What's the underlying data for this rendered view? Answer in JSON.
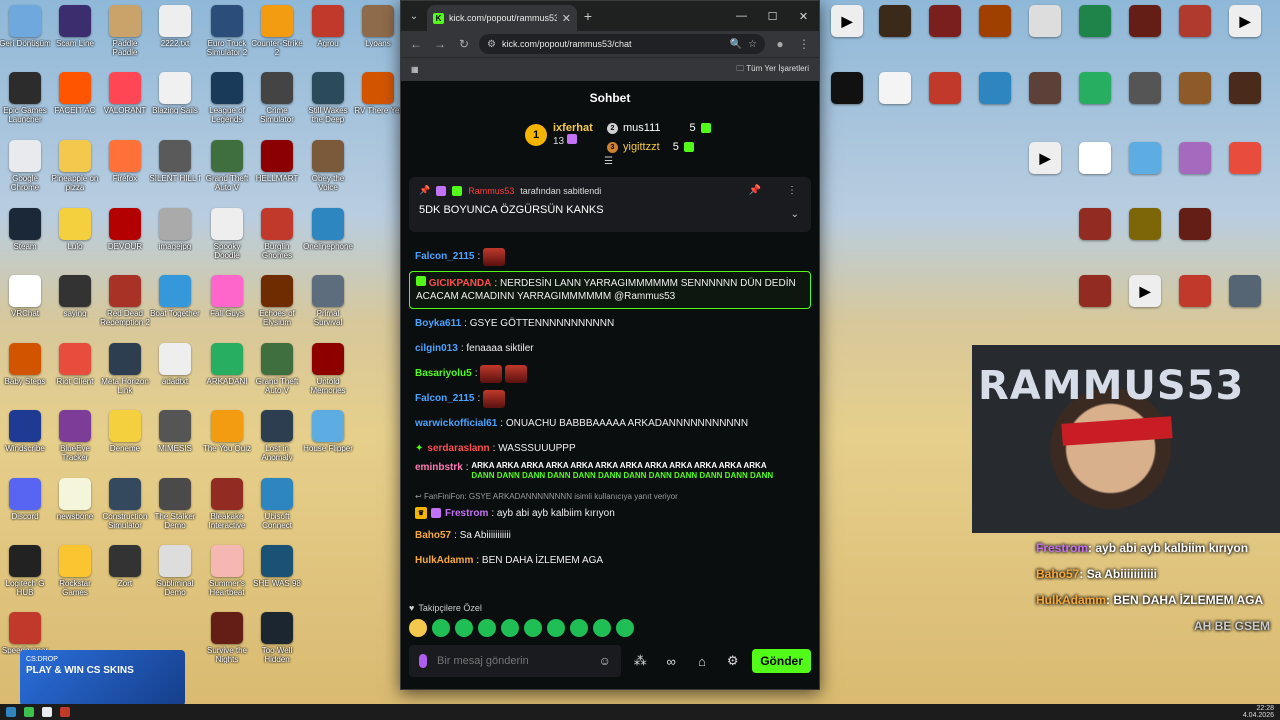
{
  "browser": {
    "tab_title": "kick.com/popout/rammus53/ch",
    "url": "kick.com/popout/rammus53/chat",
    "bookmarks_label": "Tüm Yer İşaretleri"
  },
  "chat": {
    "title": "Sohbet",
    "leaders": [
      {
        "rank": "1",
        "name": "ixferhat",
        "count": "13"
      },
      {
        "rank": "2",
        "name": "mus111",
        "count": "5"
      },
      {
        "rank": "3",
        "name": "yigittzzt",
        "count": "5"
      }
    ],
    "pinned": {
      "user": "Rammus53",
      "suffix": "tarafından sabitlendi",
      "message": "5DK BOYUNCA ÖZGÜRSÜN KANKS"
    },
    "messages": [
      {
        "user": "Falcon_2115",
        "color": "#4aa3ff",
        "text": ""
      },
      {
        "user": "GICIKPANDA",
        "color": "#ff4d4d",
        "text": "NERDESİN LANN YARRAGIMMMMMM SENNNNNN DÜN DEDİN ACACAM ACMADINN YARRAGIMMMMMM @Rammus53"
      },
      {
        "user": "Boyka611",
        "color": "#4aa3ff",
        "text": "GSYE GÖTTENNNNNNNNNNN"
      },
      {
        "user": "cilgin013",
        "color": "#4aa3ff",
        "text": "fenaaaa siktiler"
      },
      {
        "user": "Basariyolu5",
        "color": "#53fc18",
        "text": ""
      },
      {
        "user": "Falcon_2115",
        "color": "#4aa3ff",
        "text": ""
      },
      {
        "user": "warwickofficial61",
        "color": "#4aa3ff",
        "text": "ONUACHU BABBBAAAAA ARKADANNNNNNNNNNN"
      },
      {
        "user": "serdaraslann",
        "color": "#ff4d4d",
        "text": "WASSSUUUPPP"
      },
      {
        "user": "eminbstrk",
        "color": "#ff7ab6",
        "text1": "ARKA ARKA ARKA ARKA ARKA ARKA ARKA ARKA ARKA ARKA ARKA ARKA",
        "text2": "DANN DANN DANN DANN DANN DANN DANN DANN DANN DANN DANN DANN"
      },
      {
        "reply": "FanFiniFon: GSYE ARKADANNNNNNNN isimli kullanıcıya yanıt veriyor",
        "user": "Frestrom",
        "color": "#c472f5",
        "text": "ayb abi ayb kalbiim kırıyon"
      },
      {
        "user": "Baho57",
        "color": "#f7a93b",
        "text": "Sa Abiiiiiiiiiii"
      },
      {
        "user": "HulkAdamm",
        "color": "#f7a93b",
        "text": "BEN DAHA İZLEMEM AGA"
      }
    ],
    "follow_only": "Takipçilere Özel",
    "input_placeholder": "Bir mesaj gönderin",
    "send_label": "Gönder"
  },
  "overlay": {
    "brand": "RAMMUS53",
    "lines": [
      {
        "user": "Frestrom",
        "text": "ayb abi ayb kalbiim kırıyon",
        "color": "#c472f5"
      },
      {
        "user": "Baho57",
        "text": "Sa Abiiiiiiiiiii",
        "color": "#f7a93b"
      },
      {
        "user": "HulkAdamm",
        "text": "BEN DAHA İZLEMEM AGA",
        "color": "#f7a93b"
      },
      {
        "user": "",
        "text": "AH BE GSEM",
        "color": "#cccccc"
      }
    ]
  },
  "promo": {
    "tag": "CS:DROP",
    "headline": "PLAY & WIN CS SKINS"
  },
  "taskbar": {
    "time": "22:28",
    "date": "4.04.2026"
  },
  "desktop_left": [
    [
      "Geri Dönüşüm",
      "#6fa8dc"
    ],
    [
      "Scam Line",
      "#3b2d6e"
    ],
    [
      "Paddle Paddle",
      "#caa36a"
    ],
    [
      "2222.txt",
      "#eeeeee"
    ],
    [
      "Euro Truck Simulator 2",
      "#2b4d7a"
    ],
    [
      "Counter-Strike 2",
      "#f39c12"
    ],
    [
      "Agrou",
      "#c0392b"
    ],
    [
      "Lyoans",
      "#8e6b4a"
    ],
    [
      "Epic Games Launcher",
      "#2c2c2c"
    ],
    [
      "FACEIT AC",
      "#ff5500"
    ],
    [
      "VALORANT",
      "#ff4655"
    ],
    [
      "Blazing Sails",
      "#f0f0f0"
    ],
    [
      "League of Legends",
      "#1a3a5a"
    ],
    [
      "Crime Simulator",
      "#444444"
    ],
    [
      "Still Wakes the Deep",
      "#2b4a5a"
    ],
    [
      "RV There Yet",
      "#d35400"
    ],
    [
      "Google Chrome",
      "#e8eaed"
    ],
    [
      "Pineapple on pizza",
      "#f2c94c"
    ],
    [
      "Firefox",
      "#ff7139"
    ],
    [
      "SILENT HILL f",
      "#5a5a5a"
    ],
    [
      "Grand Theft Auto V",
      "#3f6f3f"
    ],
    [
      "HELLMART",
      "#8b0000"
    ],
    [
      "Obey the Voice",
      "#7a5a3a"
    ],
    [
      "",
      ""
    ],
    [
      "Steam",
      "#1b2838"
    ],
    [
      "Lulo",
      "#f4d03f"
    ],
    [
      "DEVOUR",
      "#b30000"
    ],
    [
      "imagejpg",
      "#aaaaaa"
    ],
    [
      "Spooky Doodle",
      "#eeeeee"
    ],
    [
      "Burglin Gnomes",
      "#c0392b"
    ],
    [
      "Onelinephone",
      "#2e86c1"
    ],
    [
      "",
      ""
    ],
    [
      "VRChat",
      "#ffffff"
    ],
    [
      "saying",
      "#333333"
    ],
    [
      "Red Dead Redemption 2",
      "#a93226"
    ],
    [
      "Boat Together",
      "#3498db"
    ],
    [
      "Fall Guys",
      "#ff66cc"
    ],
    [
      "Echoes of Elysium",
      "#6e2c00"
    ],
    [
      "Primal Survival",
      "#5d6d7e"
    ],
    [
      "",
      ""
    ],
    [
      "Baby Steps",
      "#d35400"
    ],
    [
      "Riot Client",
      "#e74c3c"
    ],
    [
      "Meta Horizon Link",
      "#2c3e50"
    ],
    [
      "adadtxt",
      "#eeeeee"
    ],
    [
      "ARKADANI",
      "#27ae60"
    ],
    [
      "Grand Theft Auto V",
      "#3f6f3f"
    ],
    [
      "Untold Memories",
      "#8e0000"
    ],
    [
      "",
      ""
    ],
    [
      "Windscribe",
      "#1f3a93"
    ],
    [
      "BlueEye Tracker",
      "#7d3c98"
    ],
    [
      "Deneme",
      "#f4d03f"
    ],
    [
      "MIMESIS",
      "#555555"
    ],
    [
      "The You Quiz",
      "#f39c12"
    ],
    [
      "Lost in Anomaly",
      "#2c3e50"
    ],
    [
      "House Flipper",
      "#5dade2"
    ],
    [
      "",
      ""
    ],
    [
      "Discord",
      "#5865f2"
    ],
    [
      "newsbone",
      "#f5f5dc"
    ],
    [
      "Construction Simulator",
      "#34495e"
    ],
    [
      "The Stalker Demo",
      "#4a4a4a"
    ],
    [
      "Bleakake Interactive",
      "#922b21"
    ],
    [
      "Ubisoft Connect",
      "#2e86c1"
    ],
    [
      "",
      ""
    ],
    [
      "",
      ""
    ],
    [
      "Logitech G HUB",
      "#222222"
    ],
    [
      "Rockstar Games",
      "#fbc531"
    ],
    [
      "Zort",
      "#333333"
    ],
    [
      "Subliminal Demo",
      "#dddddd"
    ],
    [
      "Summer's Heartbeat",
      "#f5b7b1"
    ],
    [
      "SHE WAS 98",
      "#1a5276"
    ],
    [
      "",
      ""
    ],
    [
      "",
      ""
    ],
    [
      "Speedrunner",
      "#c0392b"
    ],
    [
      "",
      ""
    ],
    [
      "",
      ""
    ],
    [
      "",
      ""
    ],
    [
      "Survive the Nights",
      "#641e16"
    ],
    [
      "Too Well Hidden",
      "#1b2631"
    ],
    [
      "",
      ""
    ],
    [
      "",
      ""
    ]
  ]
}
